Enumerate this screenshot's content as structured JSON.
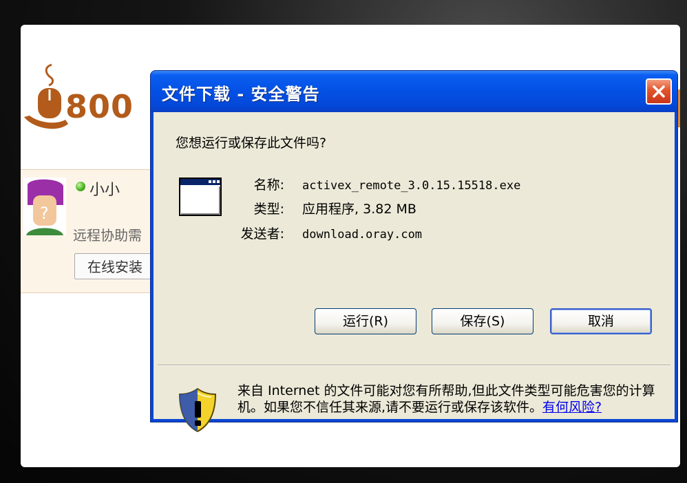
{
  "background_page": {
    "logo_text": "800",
    "user_name": "小小",
    "description": "远程协助需",
    "install_button": "在线安装"
  },
  "dialog": {
    "title": "文件下载 - 安全警告",
    "question": "您想运行或保存此文件吗?",
    "file": {
      "name_label": "名称:",
      "name_value": "activex_remote_3.0.15.15518.exe",
      "type_label": "类型:",
      "type_value": "应用程序, 3.82 MB",
      "sender_label": "发送者:",
      "sender_value": "download.oray.com"
    },
    "buttons": {
      "run": "运行(R)",
      "save": "保存(S)",
      "cancel": "取消"
    },
    "warning": {
      "text": "来自 Internet 的文件可能对您有所帮助,但此文件类型可能危害您的计算机。如果您不信任其来源,请不要运行或保存该软件。",
      "link": "有何风险?"
    }
  },
  "colors": {
    "titlebar": "#0450e4",
    "dialog_body": "#ece9d8",
    "close_button": "#e2542b",
    "logo": "#b25b1b",
    "link": "#0000ee"
  },
  "icons": [
    "close-icon",
    "file-window-icon",
    "security-shield-icon",
    "online-status-icon",
    "user-avatar-icon",
    "logo-mouse-icon"
  ]
}
